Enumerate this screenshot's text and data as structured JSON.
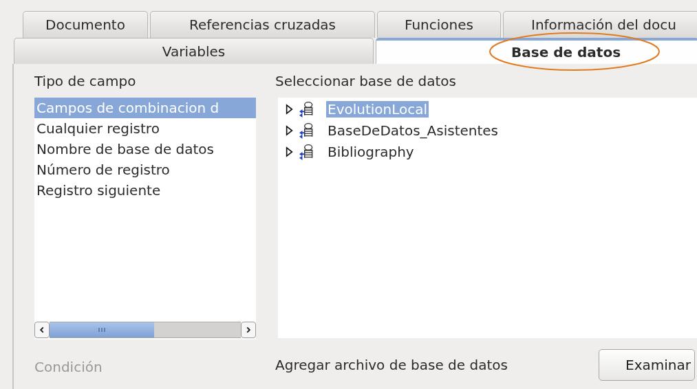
{
  "tab_rows": [
    [
      {
        "label": "Documento",
        "selected": false,
        "circled": false
      },
      {
        "label": "Referencias cruzadas",
        "selected": false,
        "circled": false
      },
      {
        "label": "Funciones",
        "selected": false,
        "circled": false
      },
      {
        "label": "Información del docu",
        "selected": false,
        "circled": false
      }
    ],
    [
      {
        "label": "Variables",
        "selected": false,
        "circled": false
      },
      {
        "label": "Base de datos",
        "selected": true,
        "circled": true
      }
    ]
  ],
  "field_type": {
    "label": "Tipo de campo",
    "items": [
      {
        "label": "Campos de combinacion d",
        "selected": true
      },
      {
        "label": "Cualquier registro",
        "selected": false
      },
      {
        "label": "Nombre de base de datos",
        "selected": false
      },
      {
        "label": "Número de registro",
        "selected": false
      },
      {
        "label": "Registro siguiente",
        "selected": false
      }
    ]
  },
  "condition": {
    "label": "Condición",
    "disabled": true
  },
  "database": {
    "label": "Seleccionar base de datos",
    "items": [
      {
        "label": "EvolutionLocal",
        "selected": true,
        "expanded": false
      },
      {
        "label": "BaseDeDatos_Asistentes",
        "selected": false,
        "expanded": false
      },
      {
        "label": "Bibliography",
        "selected": false,
        "expanded": false
      }
    ]
  },
  "add_file": {
    "label": "Agregar archivo de base de datos",
    "button": "Examinar"
  }
}
